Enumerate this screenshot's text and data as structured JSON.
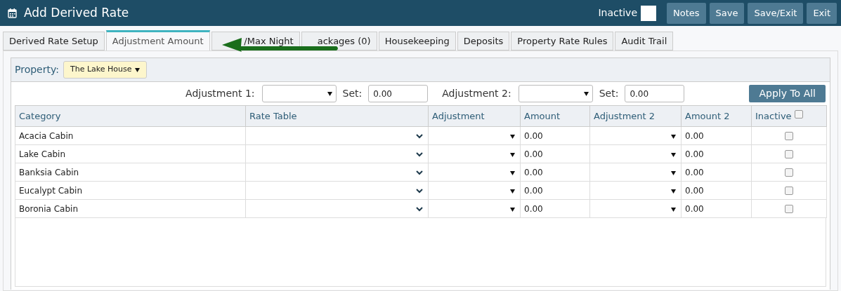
{
  "window": {
    "title": "Add Derived Rate"
  },
  "header": {
    "inactive": {
      "label": "Inactive",
      "checked": false
    },
    "buttons": [
      "Notes",
      "Save",
      "Save/Exit",
      "Exit"
    ]
  },
  "tabs": [
    {
      "label": "Derived Rate Setup",
      "selected": false
    },
    {
      "label": "Adjustment Amount",
      "selected": true
    },
    {
      "label": "/Max Night",
      "selected": false
    },
    {
      "label": "ackages (0)",
      "selected": false
    },
    {
      "label": "Housekeeping",
      "selected": false
    },
    {
      "label": "Deposits",
      "selected": false
    },
    {
      "label": "Property Rate Rules",
      "selected": false
    },
    {
      "label": "Audit Trail",
      "selected": false
    }
  ],
  "property": {
    "label": "Property:",
    "value": "The Lake House"
  },
  "adjustments": [
    {
      "label": "Adjustment 1:",
      "set_label": "Set:",
      "set_value": "0.00"
    },
    {
      "label": "Adjustment 2:",
      "set_label": "Set:",
      "set_value": "0.00"
    }
  ],
  "apply_button": "Apply To All",
  "table": {
    "columns": [
      "Category",
      "Rate Table",
      "Adjustment",
      "Amount",
      "Adjustment 2",
      "Amount 2",
      "Inactive"
    ],
    "inactive_all_checked": false,
    "rows": [
      {
        "category": "Acacia Cabin",
        "amount": "0.00",
        "amount_2": "0.00",
        "inactive": false
      },
      {
        "category": "Lake Cabin",
        "amount": "0.00",
        "amount_2": "0.00",
        "inactive": false
      },
      {
        "category": "Banksia Cabin",
        "amount": "0.00",
        "amount_2": "0.00",
        "inactive": false
      },
      {
        "category": "Eucalypt Cabin",
        "amount": "0.00",
        "amount_2": "0.00",
        "inactive": false
      },
      {
        "category": "Boronia Cabin",
        "amount": "0.00",
        "amount_2": "0.00",
        "inactive": false
      }
    ]
  }
}
